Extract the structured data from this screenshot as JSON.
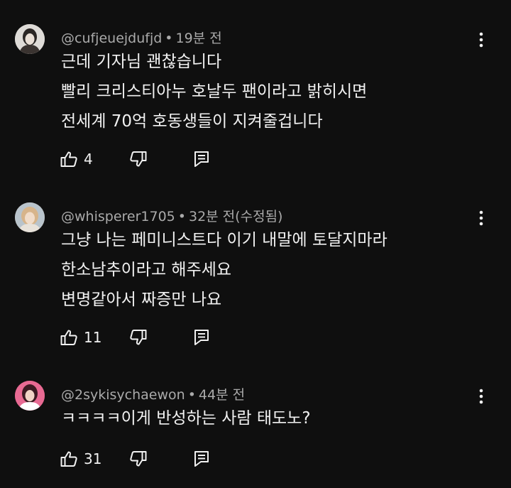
{
  "comments": [
    {
      "username": "@cufjeuejdufjd",
      "separator": "•",
      "time": "19분 전",
      "edited": "",
      "lines": [
        "근데 기자님 괜찮습니다",
        "빨리 크리스티아누 호날두 팬이라고 밝히시면",
        "전세계 70억 호동생들이 지켜줄겁니다"
      ],
      "likes": "4",
      "avatar_bg": "#d9d6d2"
    },
    {
      "username": "@whisperer1705",
      "separator": "•",
      "time": "32분 전",
      "edited": "(수정됨)",
      "lines": [
        "그냥 나는 페미니스트다 이기 내말에 토달지마라",
        "한소남추이라고 해주세요",
        "변명같아서 짜증만 나요"
      ],
      "likes": "11",
      "avatar_bg": "#c8a98c"
    },
    {
      "username": "@2sykisychaewon",
      "separator": "•",
      "time": "44분 전",
      "edited": "",
      "lines": [
        "ㅋㅋㅋㅋ이게 반성하는 사람 태도노?"
      ],
      "likes": "31",
      "avatar_bg": "#d74f7a"
    }
  ],
  "icons": {
    "like": "thumbs-up-icon",
    "dislike": "thumbs-down-icon",
    "reply": "reply-icon",
    "more": "more-vert-icon"
  },
  "colors": {
    "background": "#0f0f0f",
    "text": "#f1f1f1",
    "meta": "#aaaaaa"
  }
}
